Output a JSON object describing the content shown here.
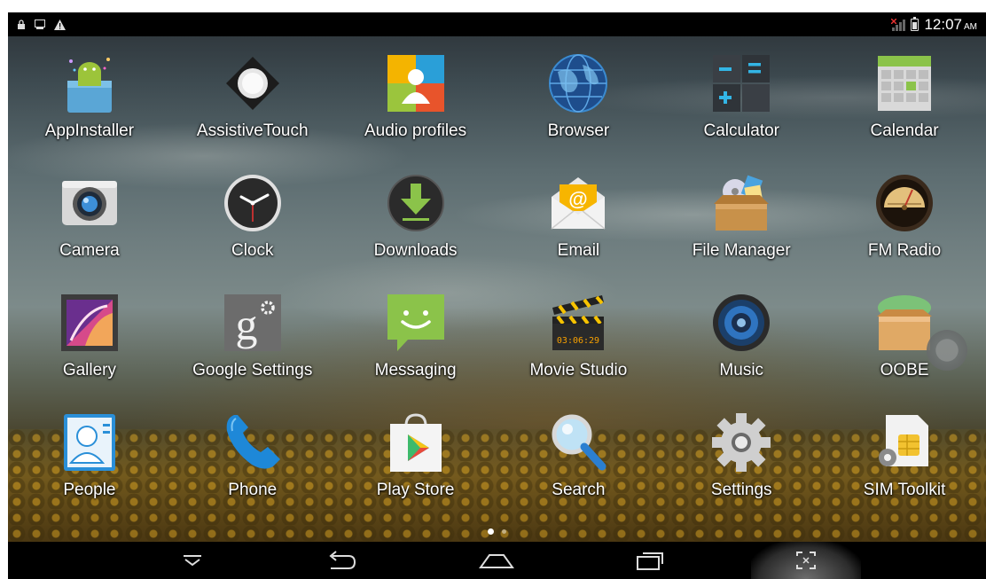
{
  "status_bar": {
    "time": "12:07",
    "ampm": "AM"
  },
  "apps": [
    {
      "label": "AppInstaller",
      "icon": "app-installer-icon"
    },
    {
      "label": "AssistiveTouch",
      "icon": "assistive-touch-icon"
    },
    {
      "label": "Audio profiles",
      "icon": "audio-profiles-icon"
    },
    {
      "label": "Browser",
      "icon": "browser-globe-icon"
    },
    {
      "label": "Calculator",
      "icon": "calculator-icon"
    },
    {
      "label": "Calendar",
      "icon": "calendar-icon"
    },
    {
      "label": "Camera",
      "icon": "camera-icon"
    },
    {
      "label": "Clock",
      "icon": "clock-icon"
    },
    {
      "label": "Downloads",
      "icon": "downloads-icon"
    },
    {
      "label": "Email",
      "icon": "email-icon"
    },
    {
      "label": "File Manager",
      "icon": "file-manager-icon"
    },
    {
      "label": "FM Radio",
      "icon": "fm-radio-icon"
    },
    {
      "label": "Gallery",
      "icon": "gallery-icon"
    },
    {
      "label": "Google Settings",
      "icon": "google-settings-icon"
    },
    {
      "label": "Messaging",
      "icon": "messaging-icon"
    },
    {
      "label": "Movie Studio",
      "icon": "movie-studio-icon"
    },
    {
      "label": "Music",
      "icon": "music-speaker-icon"
    },
    {
      "label": "OOBE",
      "icon": "oobe-box-icon"
    },
    {
      "label": "People",
      "icon": "people-icon"
    },
    {
      "label": "Phone",
      "icon": "phone-icon"
    },
    {
      "label": "Play Store",
      "icon": "play-store-icon"
    },
    {
      "label": "Search",
      "icon": "search-icon"
    },
    {
      "label": "Settings",
      "icon": "settings-gear-icon"
    },
    {
      "label": "SIM Toolkit",
      "icon": "sim-toolkit-icon"
    }
  ],
  "movie_studio_timecode": "03:06:29",
  "google_settings_glyph": "g",
  "email_glyph": "@",
  "colors": {
    "status_bar_bg": "#000000",
    "nav_bar_bg": "#000000",
    "label_text": "#ffffff"
  }
}
